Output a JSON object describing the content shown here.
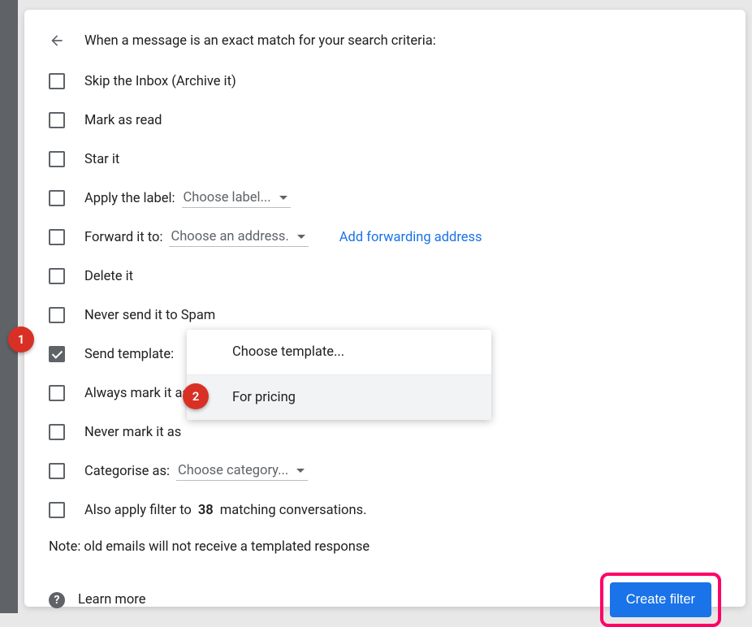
{
  "header": "When a message is an exact match for your search criteria:",
  "options": {
    "skip_inbox": "Skip the Inbox (Archive it)",
    "mark_read": "Mark as read",
    "star": "Star it",
    "apply_label": "Apply the label:",
    "apply_label_dropdown": "Choose label...",
    "forward": "Forward it to:",
    "forward_dropdown": "Choose an address.",
    "forward_link": "Add forwarding address",
    "delete": "Delete it",
    "never_spam": "Never send it to Spam",
    "send_template": "Send template:",
    "always_important": "Always mark it as",
    "never_important": "Never mark it as",
    "categorise": "Categorise as:",
    "categorise_dropdown": "Choose category...",
    "also_apply_prefix": "Also apply filter to ",
    "also_apply_count": "38",
    "also_apply_suffix": " matching conversations."
  },
  "popover": {
    "items": [
      "Choose template...",
      "For pricing"
    ]
  },
  "note": "Note: old emails will not receive a templated response",
  "learn_more": "Learn more",
  "create_button": "Create filter",
  "step_badges": [
    "1",
    "2"
  ]
}
